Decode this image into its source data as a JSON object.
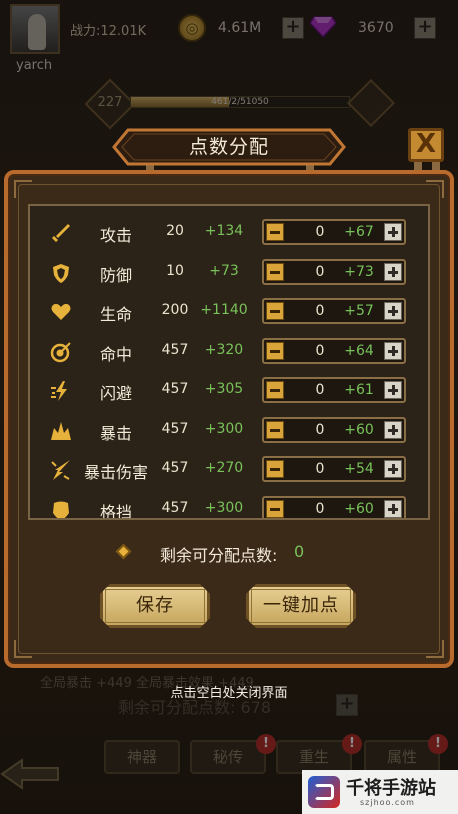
{
  "player": {
    "name": "yarch",
    "power": "战力:12.01K",
    "gold": "4.61M",
    "gems": "3670",
    "level": "227",
    "exp": "461/2/51050",
    "exp_fraction": 0.45
  },
  "background": {
    "attr_row": "全局暴击        +449         全局暴击效果          +449",
    "remaining": "剩余可分配点数: 678",
    "tabs": [
      {
        "label": "神器",
        "badge": ""
      },
      {
        "label": "秘传",
        "badge": "!"
      },
      {
        "label": "重生",
        "badge": "!"
      },
      {
        "label": "属性",
        "badge": "!"
      }
    ]
  },
  "dialog": {
    "title": "点数分配",
    "close_label": "X",
    "attributes": [
      {
        "name": "攻击",
        "icon": "sword-icon",
        "base": "20",
        "bonus": "+134",
        "value": "0",
        "gain": "+67"
      },
      {
        "name": "防御",
        "icon": "shield-icon",
        "base": "10",
        "bonus": "+73",
        "value": "0",
        "gain": "+73"
      },
      {
        "name": "生命",
        "icon": "heart-icon",
        "base": "200",
        "bonus": "+1140",
        "value": "0",
        "gain": "+57"
      },
      {
        "name": "命中",
        "icon": "target-icon",
        "base": "457",
        "bonus": "+320",
        "value": "0",
        "gain": "+64"
      },
      {
        "name": "闪避",
        "icon": "dodge-icon",
        "base": "457",
        "bonus": "+305",
        "value": "0",
        "gain": "+61"
      },
      {
        "name": "暴击",
        "icon": "crit-icon",
        "base": "457",
        "bonus": "+300",
        "value": "0",
        "gain": "+60"
      },
      {
        "name": "暴击伤害",
        "icon": "crit-damage-icon",
        "base": "457",
        "bonus": "+270",
        "value": "0",
        "gain": "+54"
      },
      {
        "name": "格挡",
        "icon": "block-icon",
        "base": "457",
        "bonus": "+300",
        "value": "0",
        "gain": "+60"
      }
    ],
    "remaining_label": "剩余可分配点数:",
    "remaining_value": "0",
    "save_label": "保存",
    "auto_label": "一键加点",
    "close_hint": "点击空白处关闭界面"
  },
  "watermark": {
    "text": "千将手游站",
    "sub": "szjhoo.com"
  },
  "colors": {
    "frame_orange": "#b96b2e",
    "bonus_green": "#79c15a",
    "button_gold": "#e6cf93",
    "icon_gold": "#e7b23b"
  }
}
